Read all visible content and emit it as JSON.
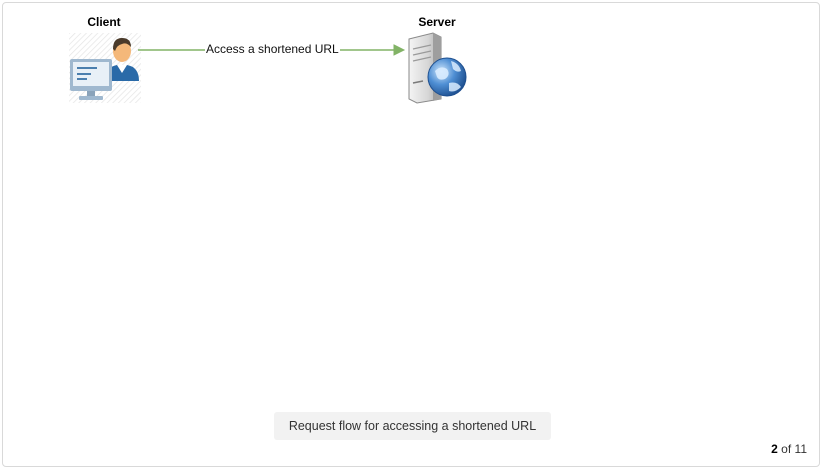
{
  "diagram": {
    "nodes": {
      "client": {
        "label": "Client",
        "icon": "client-user-computer-icon"
      },
      "server": {
        "label": "Server",
        "icon": "web-server-globe-icon"
      }
    },
    "edges": [
      {
        "from": "client",
        "to": "server",
        "label": "Access a shortened URL",
        "color": "#82b366"
      }
    ]
  },
  "caption": "Request flow for accessing a shortened URL",
  "pager": {
    "current": "2",
    "of_text": "of",
    "total": "11"
  }
}
